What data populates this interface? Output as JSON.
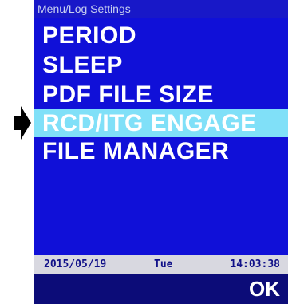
{
  "screen": {
    "title": "Menu/Log Settings",
    "background_color": "#1010d8",
    "selected_color": "#80e0f8"
  },
  "menu": {
    "items": [
      {
        "label": "PERIOD",
        "selected": false
      },
      {
        "label": "SLEEP",
        "selected": false
      },
      {
        "label": "PDF  FILE  SIZE",
        "selected": false
      },
      {
        "label": "RCD/ITG ENGAGE",
        "selected": true
      },
      {
        "label": "FILE MANAGER",
        "selected": false
      }
    ]
  },
  "status_bar": {
    "date": "2015/05/19",
    "day": "Tue",
    "time": "14:03:38"
  },
  "footer": {
    "ok_label": "OK"
  },
  "pointer": {
    "icon": "right-arrow-icon"
  }
}
